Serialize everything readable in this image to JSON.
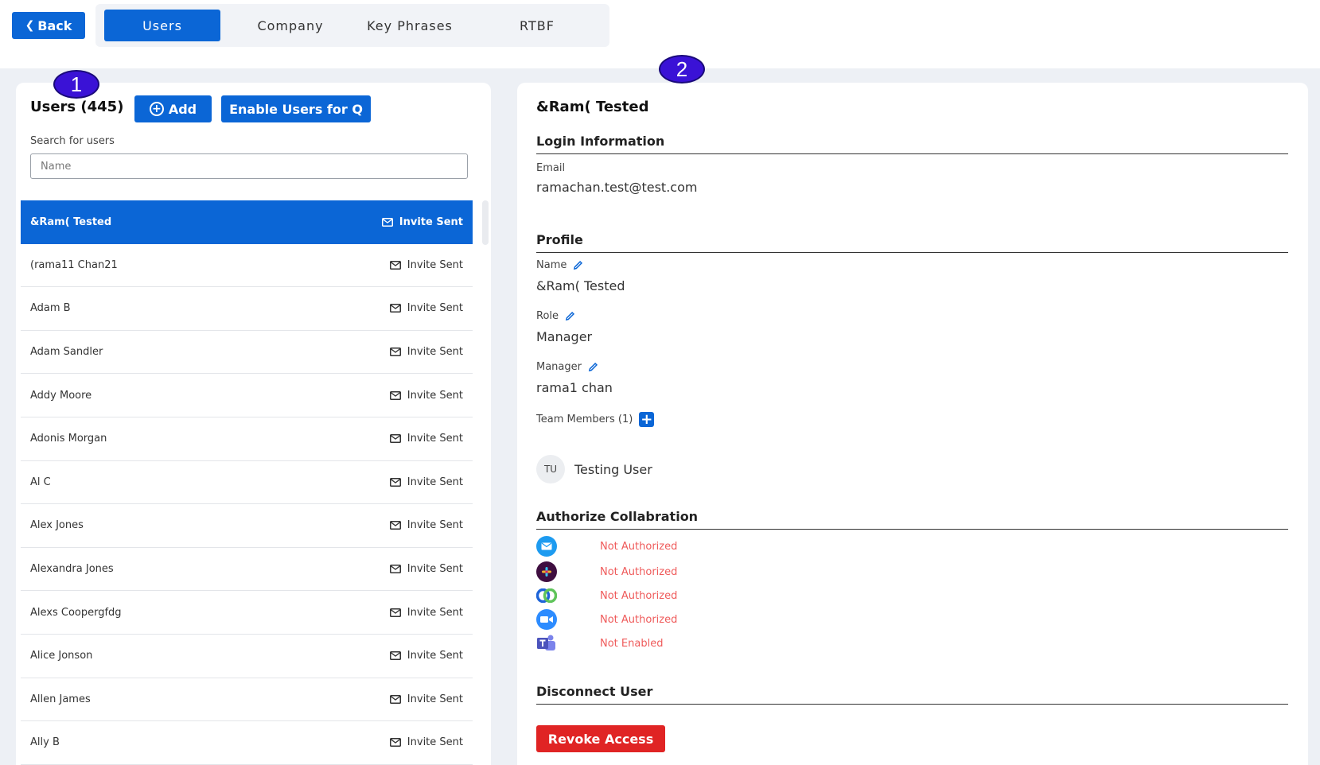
{
  "nav": {
    "back_label": "Back",
    "tabs": [
      {
        "label": "Users",
        "active": true
      },
      {
        "label": "Company",
        "active": false
      },
      {
        "label": "Key Phrases",
        "active": false
      },
      {
        "label": "RTBF",
        "active": false
      }
    ]
  },
  "callouts": {
    "one": "1",
    "two": "2"
  },
  "users_panel": {
    "title": "Users (445)",
    "add_label": "Add",
    "enable_label": "Enable Users for Q",
    "search_label": "Search for users",
    "search_placeholder": "Name",
    "users": [
      {
        "name": "&Ram( Tested",
        "status": "Invite Sent",
        "selected": true
      },
      {
        "name": "(rama11 Chan21",
        "status": "Invite Sent"
      },
      {
        "name": "Adam B",
        "status": "Invite Sent"
      },
      {
        "name": "Adam Sandler",
        "status": "Invite Sent"
      },
      {
        "name": "Addy Moore",
        "status": "Invite Sent"
      },
      {
        "name": "Adonis Morgan",
        "status": "Invite Sent"
      },
      {
        "name": "Al C",
        "status": "Invite Sent"
      },
      {
        "name": "Alex Jones",
        "status": "Invite Sent"
      },
      {
        "name": "Alexandra Jones",
        "status": "Invite Sent"
      },
      {
        "name": "Alexs Coopergfdg",
        "status": "Invite Sent"
      },
      {
        "name": "Alice Jonson",
        "status": "Invite Sent"
      },
      {
        "name": "Allen James",
        "status": "Invite Sent"
      },
      {
        "name": "Ally B",
        "status": "Invite Sent"
      }
    ]
  },
  "detail": {
    "title": "&Ram( Tested",
    "login_section": "Login Information",
    "email_label": "Email",
    "email_value": "ramachan.test@test.com",
    "profile_section": "Profile",
    "name_label": "Name",
    "name_value": "&Ram( Tested",
    "role_label": "Role",
    "role_value": "Manager",
    "manager_label": "Manager",
    "manager_value": "rama1 chan",
    "team_label": "Team Members (1)",
    "member_initials": "TU",
    "member_name": "Testing User",
    "collab_section": "Authorize Collabration",
    "collab": [
      {
        "icon": "email-icon",
        "status": "Not Authorized"
      },
      {
        "icon": "slack-icon",
        "status": "Not Authorized"
      },
      {
        "icon": "webex-icon",
        "status": "Not Authorized"
      },
      {
        "icon": "zoom-icon",
        "status": "Not Authorized"
      },
      {
        "icon": "teams-icon",
        "status": "Not Enabled"
      }
    ],
    "disconnect_section": "Disconnect User",
    "revoke_label": "Revoke Access"
  },
  "colors": {
    "primary": "#0b66d6",
    "danger": "#e02424",
    "warning_text": "#ef5b5b",
    "callout": "#3a12d6"
  }
}
